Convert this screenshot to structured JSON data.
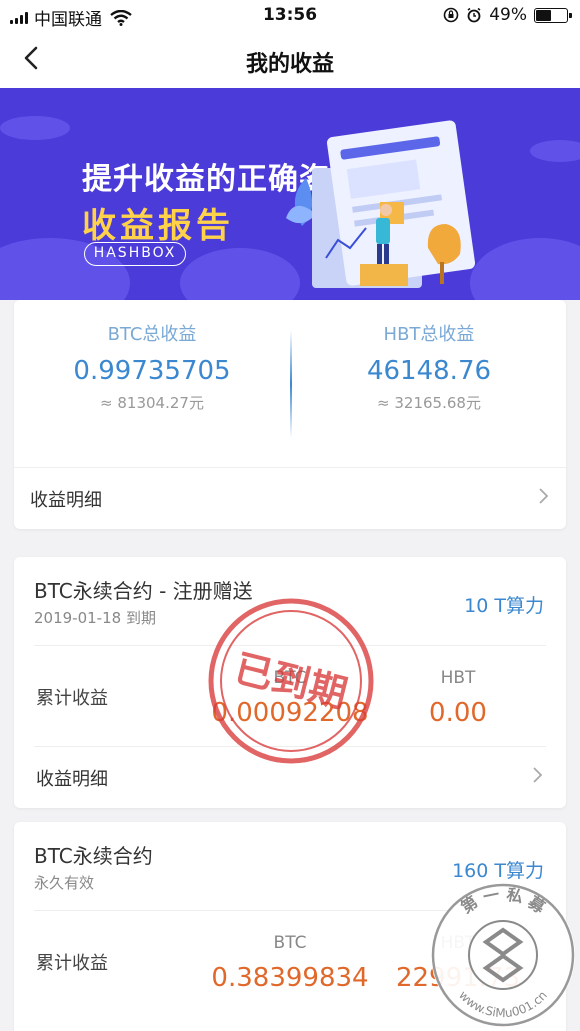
{
  "status_bar": {
    "carrier": "中国联通",
    "time": "13:56",
    "battery_percent": "49%",
    "battery_level": 0.49
  },
  "header": {
    "title": "我的收益"
  },
  "banner": {
    "headline": "提升收益的正确姿势",
    "subheadline": "收益报告",
    "brand": "HASHBOX"
  },
  "summary": {
    "btc": {
      "label": "BTC总收益",
      "value": "0.99735705",
      "cny": "≈ 81304.27元"
    },
    "hbt": {
      "label": "HBT总收益",
      "value": "46148.76",
      "cny": "≈ 32165.68元"
    },
    "detail_label": "收益明细"
  },
  "contracts": [
    {
      "name": "BTC永续合约 - 注册赠送",
      "status": "2019-01-18 到期",
      "power": "10 T算力",
      "earnings_label": "累计收益",
      "btc_label": "BTC",
      "btc_value": "0.00092208",
      "hbt_label": "HBT",
      "hbt_value": "0.00",
      "detail_label": "收益明细",
      "stamp": "已到期"
    },
    {
      "name": "BTC永续合约",
      "status": "永久有效",
      "power": "160 T算力",
      "earnings_label": "累计收益",
      "btc_label": "BTC",
      "btc_value": "0.38399834",
      "hbt_label": "HBT",
      "hbt_value": "22991.73"
    }
  ],
  "watermark": {
    "top_text": "第 一 私 募",
    "bottom_text": "www.SiMu001.cn"
  },
  "colors": {
    "accent_blue": "#3b88d0",
    "earnings_orange": "#e0682a",
    "banner_purple": "#4b3bd9",
    "banner_yellow": "#ffd24a",
    "stamp_red": "#d93a3a"
  }
}
